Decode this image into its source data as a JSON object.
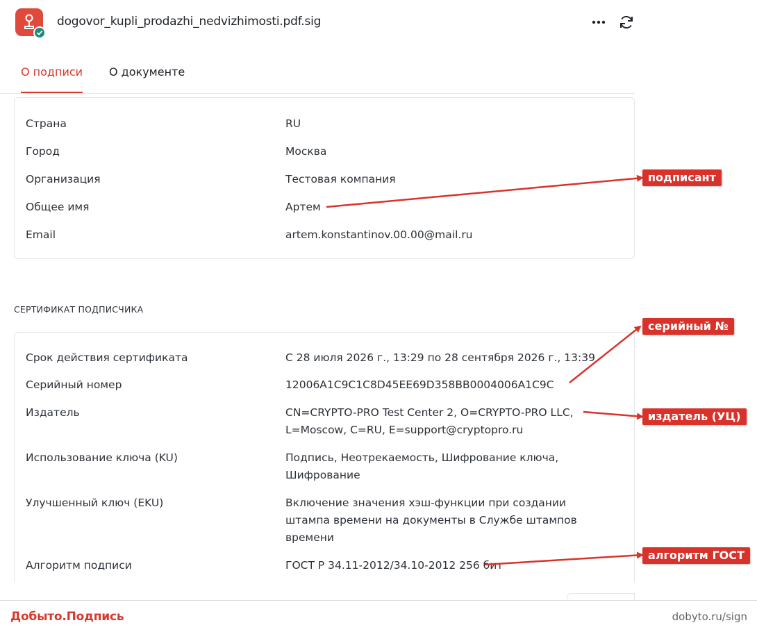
{
  "header": {
    "file_name": "dogovor_kupli_prodazhi_nedvizhimosti.pdf.sig",
    "app_icon": "signature-app-icon",
    "more_icon": "more-horizontal-icon",
    "refresh_icon": "refresh-icon"
  },
  "tabs": [
    {
      "label": "О подписи",
      "active": true
    },
    {
      "label": "О документе",
      "active": false
    }
  ],
  "signer_card": {
    "rows": [
      {
        "label": "Страна",
        "value": "RU"
      },
      {
        "label": "Город",
        "value": "Москва"
      },
      {
        "label": "Организация",
        "value": "Тестовая компания"
      },
      {
        "label": "Общее имя",
        "value": "Артем"
      },
      {
        "label": "Email",
        "value": "artem.konstantinov.00.00@mail.ru"
      }
    ]
  },
  "certificate_section": {
    "title": "СЕРТИФИКАТ ПОДПИСЧИКА",
    "rows": [
      {
        "label": "Срок действия сертификата",
        "value": "С 28 июля 2026 г., 13:29 по 28 сентября 2026 г., 13:39"
      },
      {
        "label": "Серийный номер",
        "value": "12006A1C9C1C8D45EE69D358BB0004006A1C9C"
      },
      {
        "label": "Издатель",
        "value": "CN=CRYPTO-PRO Test Center 2, O=CRYPTO-PRO LLC, L=Moscow, C=RU, E=support@cryptopro.ru"
      },
      {
        "label": "Использование ключа (KU)",
        "value": "Подпись, Неотрекаемость, Шифрование ключа, Шифрование"
      },
      {
        "label": "Улучшенный ключ (EKU)",
        "value": "Включение значения хэш-функции при создании штампа времени на документы в Службе штампов времени"
      },
      {
        "label": "Алгоритм подписи",
        "value": "ГОСТ Р 34.11-2012/34.10-2012 256 бит"
      }
    ]
  },
  "annotations": {
    "signer": "подписант",
    "serial": "серийный №",
    "issuer": "издатель (УЦ)",
    "algorithm": "алгоритм ГОСТ",
    "color": "#d9322b"
  },
  "footer": {
    "brand": "Добыто.Подпись",
    "site": "dobyto.ru/sign"
  },
  "colors": {
    "accent": "#d8382c",
    "badge": "#1e8a7a",
    "border": "#e3e5e8"
  }
}
